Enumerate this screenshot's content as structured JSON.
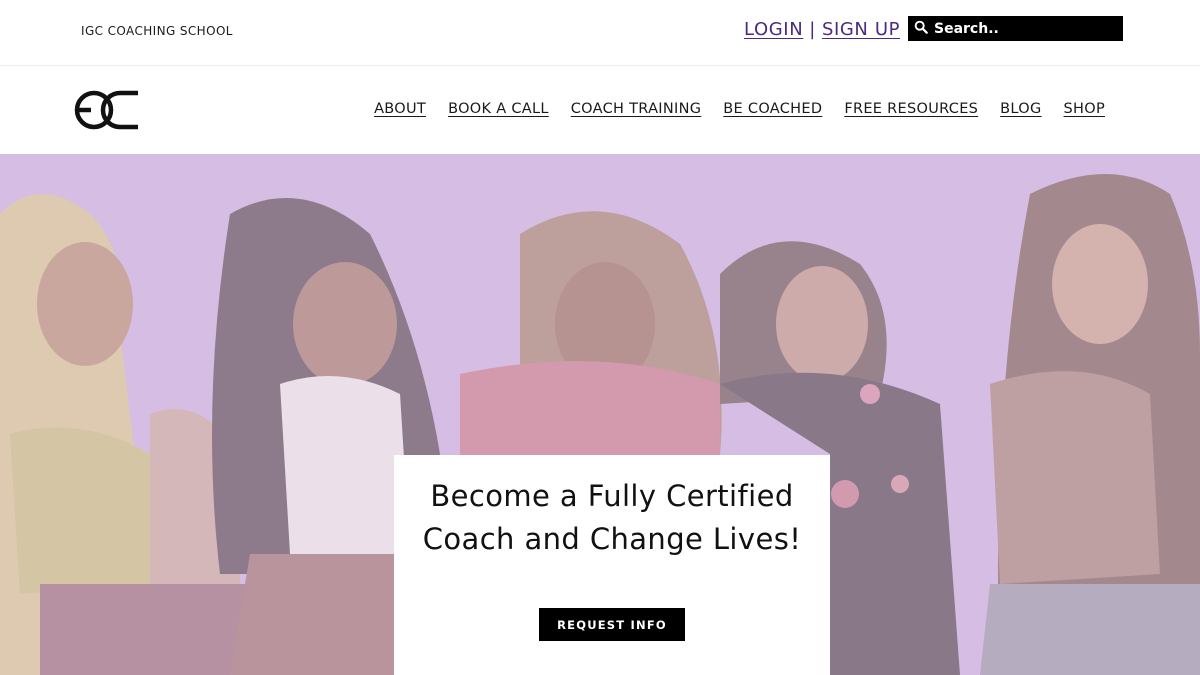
{
  "header": {
    "school_name": "IGC COACHING SCHOOL",
    "login_label": "LOGIN",
    "separator": "|",
    "signup_label": "SIGN UP",
    "search": {
      "placeholder": "Search..",
      "icon": "search-icon"
    }
  },
  "nav": {
    "logo": "igc-logo",
    "items": [
      {
        "label": "ABOUT"
      },
      {
        "label": "BOOK A CALL"
      },
      {
        "label": "COACH TRAINING"
      },
      {
        "label": "BE COACHED"
      },
      {
        "label": "FREE RESOURCES"
      },
      {
        "label": "BLOG"
      },
      {
        "label": "SHOP"
      }
    ]
  },
  "hero": {
    "title_line1": "Become a Fully Certified",
    "title_line2": "Coach and Change Lives!",
    "cta_label": "REQUEST INFO"
  },
  "colors": {
    "hero_background": "#cbb0dc",
    "link": "#4b2a7f",
    "search_bg": "#000000",
    "cta_bg": "#000000"
  }
}
